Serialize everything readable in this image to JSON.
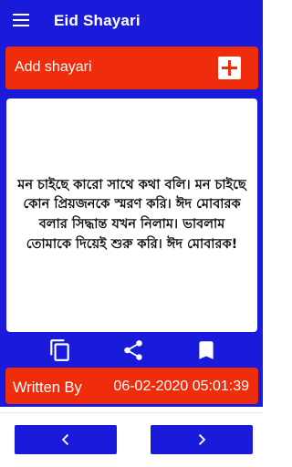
{
  "app_bar": {
    "title": "Eid Shayari",
    "menu_icon": "menu-icon"
  },
  "add_bar": {
    "label": "Add shayari",
    "add_icon": "plus-icon"
  },
  "shayari": {
    "text": "মন চাইছে কারো সাথে কথা বলি। মন চাইছে কোন প্রিয়জনকে স্মরণ করি। ঈদ মোবারক বলার সিদ্ধান্ত যখন নিলাম। ভাবলাম তোমাকে দিয়েই শুরু করি।  ঈদ মোবারক!"
  },
  "actions": [
    "copy-icon",
    "share-icon",
    "bookmark-icon"
  ],
  "footer": {
    "written_label": "Written By",
    "date": "06-02-2020 05:01:39"
  },
  "nav": {
    "prev_icon": "chevron-left-icon",
    "next_icon": "chevron-right-icon"
  },
  "colors": {
    "primary_blue": "#1a1adb",
    "accent_red": "#ef2d0c",
    "white": "#ffffff"
  }
}
